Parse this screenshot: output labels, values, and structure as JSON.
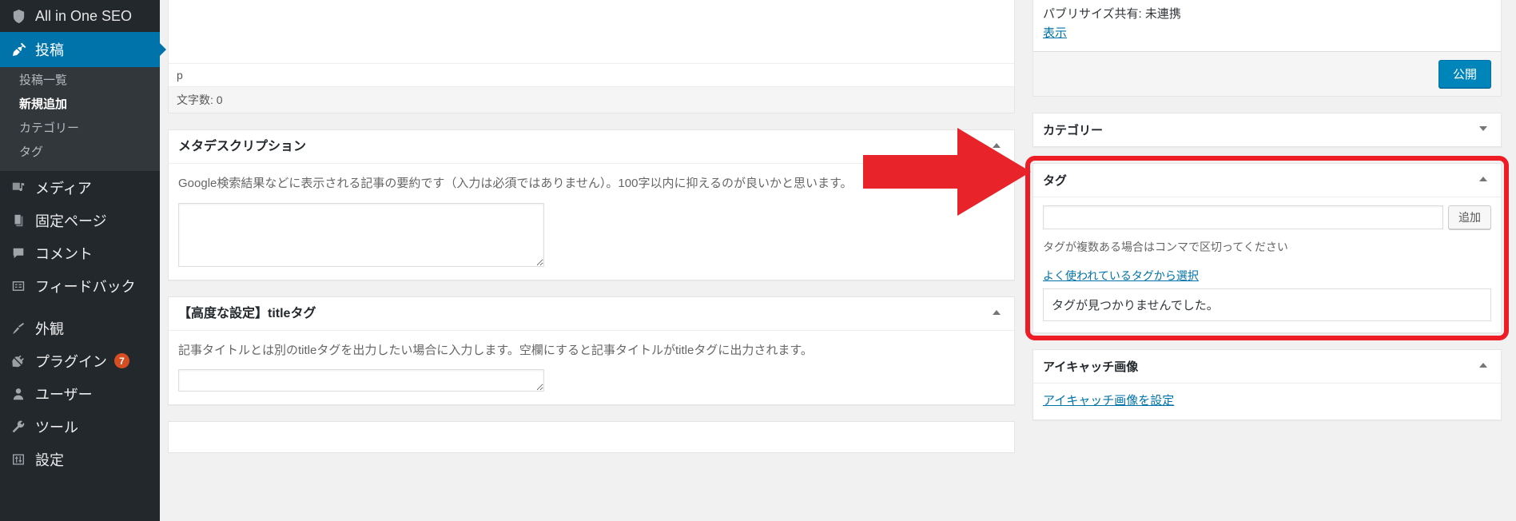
{
  "sidebar": {
    "brand": {
      "label": "All in One SEO",
      "icon": "shield-icon"
    },
    "current": {
      "label": "投稿",
      "icon": "pin-icon"
    },
    "submenu": [
      {
        "label": "投稿一覧",
        "active": false
      },
      {
        "label": "新規追加",
        "active": true
      },
      {
        "label": "カテゴリー",
        "active": false
      },
      {
        "label": "タグ",
        "active": false
      }
    ],
    "items": [
      {
        "label": "メディア",
        "icon": "media-icon",
        "badge": ""
      },
      {
        "label": "固定ページ",
        "icon": "pages-icon",
        "badge": ""
      },
      {
        "label": "コメント",
        "icon": "comment-icon",
        "badge": ""
      },
      {
        "label": "フィードバック",
        "icon": "feedback-icon",
        "badge": ""
      },
      {
        "label": "外観",
        "icon": "appearance-icon",
        "badge": ""
      },
      {
        "label": "プラグイン",
        "icon": "plugin-icon",
        "badge": "7"
      },
      {
        "label": "ユーザー",
        "icon": "user-icon",
        "badge": ""
      },
      {
        "label": "ツール",
        "icon": "tools-icon",
        "badge": ""
      },
      {
        "label": "設定",
        "icon": "settings-icon",
        "badge": ""
      }
    ]
  },
  "editor": {
    "path": "p",
    "word_count": "文字数: 0"
  },
  "meta_description": {
    "title": "メタデスクリプション",
    "toggle_icon": "chevron-up-icon",
    "help": "Google検索結果などに表示される記事の要約です（入力は必須ではありません）。100字以内に抑えるのが良いかと思います。",
    "value": "",
    "placeholder": ""
  },
  "title_tag": {
    "title": "【高度な設定】titleタグ",
    "toggle_icon": "chevron-up-icon",
    "help": "記事タイトルとは別のtitleタグを出力したい場合に入力します。空欄にすると記事タイトルがtitleタグに出力されます。",
    "value": "",
    "placeholder": ""
  },
  "publish_box": {
    "publicize_label": "パブリサイズ共有: 未連携",
    "publicize_edit": "表示",
    "publish_button": "公開"
  },
  "categories_box": {
    "title": "カテゴリー",
    "toggle_icon": "chevron-down-icon"
  },
  "tags_box": {
    "title": "タグ",
    "toggle_icon": "chevron-up-icon",
    "input_value": "",
    "input_placeholder": "",
    "add_button": "追加",
    "hint": "タグが複数ある場合はコンマで区切ってください",
    "choose_link": "よく使われているタグから選択",
    "cloud_message": "タグが見つかりませんでした。"
  },
  "featured_image_box": {
    "title": "アイキャッチ画像",
    "toggle_icon": "chevron-up-icon",
    "set_link": "アイキャッチ画像を設定"
  },
  "annotations": {
    "arrow_color": "#e8232a",
    "highlight_color": "#ee1c25",
    "arrow_name": "red-arrow-pointing-to-tags",
    "highlight_name": "red-highlight-around-tags-box"
  },
  "colors": {
    "sidebar_bg": "#23282d",
    "submenu_bg": "#32373c",
    "accent_blue": "#0073aa",
    "button_blue": "#0085ba",
    "badge_orange": "#d54e21",
    "page_bg": "#f1f1f1"
  }
}
